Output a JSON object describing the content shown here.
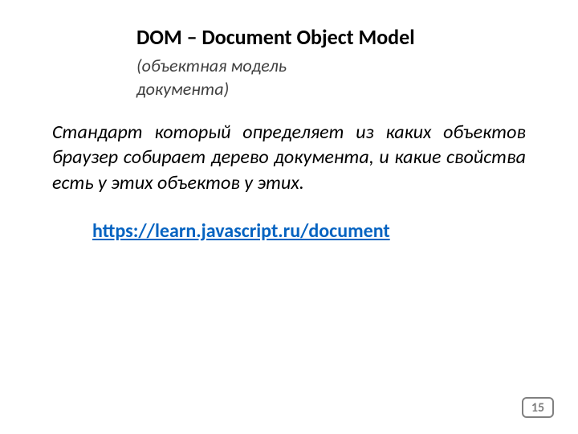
{
  "title": "DOM – Document Object Model",
  "subtitle": "(объектная модель документа)",
  "body": "Стандарт который определяет из каких объектов браузер собирает дерево документа, и какие свойства есть у этих объектов у этих.",
  "link": "https://learn.javascript.ru/document",
  "pageNumber": "15"
}
